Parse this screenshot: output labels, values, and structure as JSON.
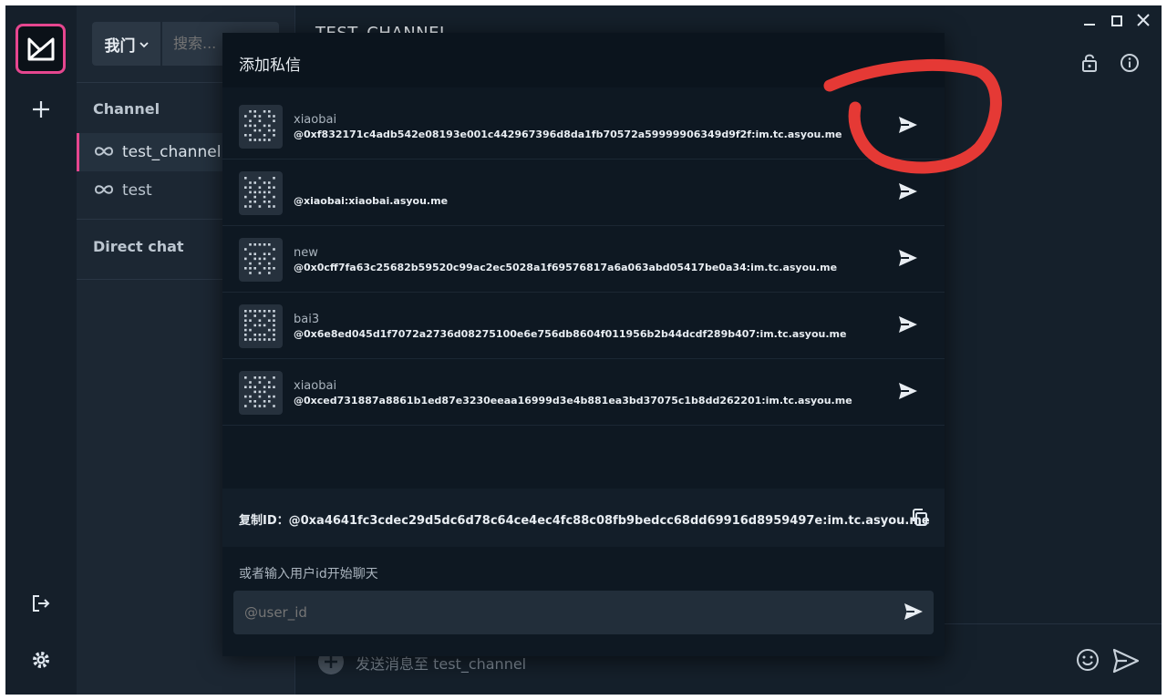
{
  "rooms": {
    "space_label": "我门",
    "search_placeholder": "搜索...",
    "channel_section": "Channel",
    "channels": [
      {
        "name": "test_channel",
        "active": true
      },
      {
        "name": "test",
        "active": false
      }
    ],
    "direct_section": "Direct chat"
  },
  "main": {
    "title": "TEST_CHANNEL",
    "composer_placeholder": "发送消息至 test_channel"
  },
  "modal": {
    "title": "添加私信",
    "users": [
      {
        "name": "xiaobai",
        "id": "@0xf832171c4adb542e08193e001c442967396d8da1fb70572a59999906349d9f2f:im.tc.asyou.me"
      },
      {
        "name": "",
        "id": "@xiaobai:xiaobai.asyou.me"
      },
      {
        "name": "new",
        "id": "@0x0cff7fa63c25682b59520c99ac2ec5028a1f69576817a6a063abd05417be0a34:im.tc.asyou.me"
      },
      {
        "name": "bai3",
        "id": "@0x6e8ed045d1f7072a2736d08275100e6e756db8604f011956b2b44dcdf289b407:im.tc.asyou.me"
      },
      {
        "name": "xiaobai",
        "id": "@0xced731887a8861b1ed87e3230eeaa16999d3e4b881ea3bd37075c1b8dd262201:im.tc.asyou.me"
      }
    ],
    "copy_label": "复制ID：@0xa4641fc3cdec29d5dc6d78c64ce4ec4fc88c08fb9bedcc68dd69916d8959497e:im.tc.asyou.me",
    "hint": "或者输入用户id开始聊天",
    "input_placeholder": "@user_id"
  },
  "colors": {
    "accent": "#e6468f",
    "annotation": "#e53935",
    "background": "#15202b"
  },
  "icons": [
    "logo-icon",
    "plus-icon",
    "logout-icon",
    "settings-icon",
    "send-icon",
    "copy-icon",
    "lock-icon",
    "info-icon",
    "emoji-icon"
  ]
}
